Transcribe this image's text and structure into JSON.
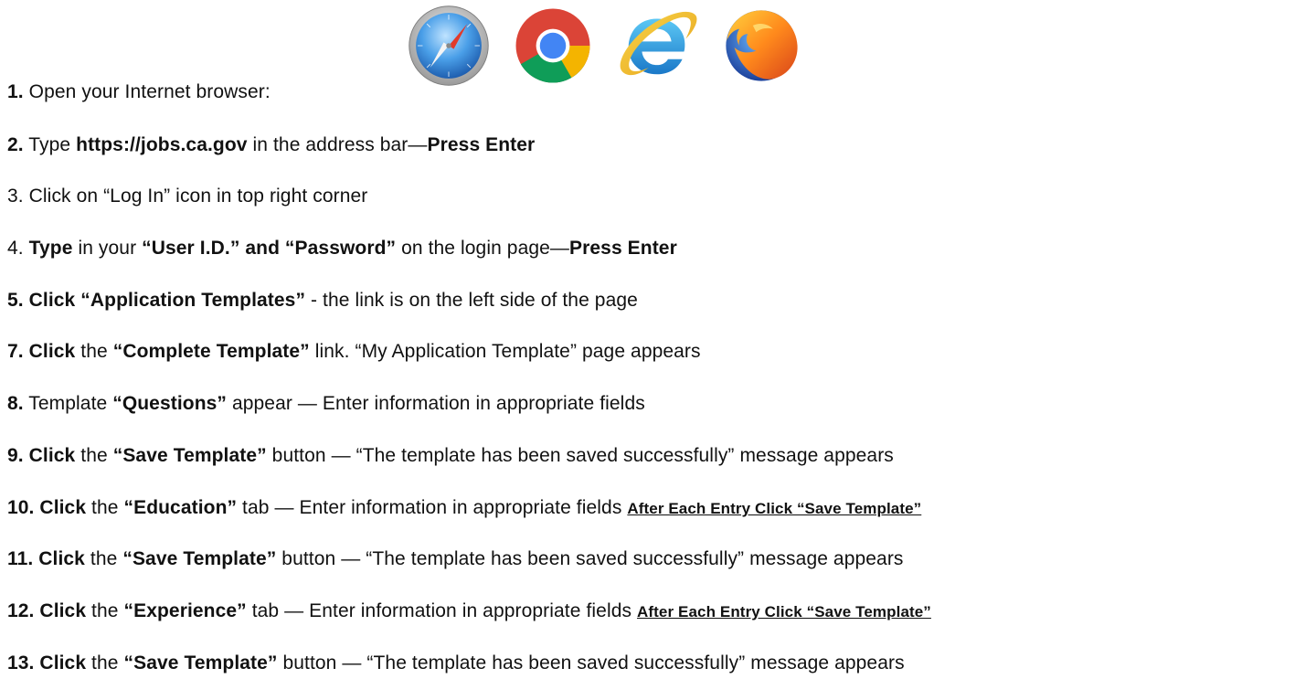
{
  "steps": [
    {
      "id": "step-1",
      "parts": [
        {
          "text": "1.",
          "bold": true
        },
        {
          "text": "  Open your Internet browser:",
          "bold": false
        }
      ]
    },
    {
      "id": "step-2",
      "parts": [
        {
          "text": "2.",
          "bold": true
        },
        {
          "text": " Type ",
          "bold": false
        },
        {
          "text": "https://jobs.ca.gov",
          "bold": true
        },
        {
          "text": " in the address bar—",
          "bold": false
        },
        {
          "text": "Press Enter",
          "bold": true
        }
      ]
    },
    {
      "id": "step-3",
      "parts": [
        {
          "text": "3. Click on “Log In” icon in top right corner",
          "bold": false
        }
      ]
    },
    {
      "id": "step-4",
      "parts": [
        {
          "text": "4. ",
          "bold": false
        },
        {
          "text": "Type",
          "bold": true
        },
        {
          "text": " in your ",
          "bold": false
        },
        {
          "text": "“User I.D.” and “Password”",
          "bold": true
        },
        {
          "text": " on the login page—",
          "bold": false
        },
        {
          "text": "Press Enter",
          "bold": true
        }
      ]
    },
    {
      "id": "step-5",
      "parts": [
        {
          "text": "5. Click  “Application Templates”",
          "bold": true
        },
        {
          "text": " -  the link is on the left side of the page",
          "bold": false
        }
      ]
    },
    {
      "id": "step-7",
      "parts": [
        {
          "text": "7. Click",
          "bold": true
        },
        {
          "text": " the ",
          "bold": false
        },
        {
          "text": "“Complete Template”",
          "bold": true
        },
        {
          "text": " link. “My Application Template” page appears",
          "bold": false
        }
      ]
    },
    {
      "id": "step-8",
      "parts": [
        {
          "text": "8.",
          "bold": true
        },
        {
          "text": " Template ",
          "bold": false
        },
        {
          "text": "“Questions”",
          "bold": true
        },
        {
          "text": " appear — Enter information in appropriate fields",
          "bold": false
        }
      ]
    },
    {
      "id": "step-9",
      "parts": [
        {
          "text": "9. Click",
          "bold": true
        },
        {
          "text": " the ",
          "bold": false
        },
        {
          "text": "“Save Template”",
          "bold": true
        },
        {
          "text": " button — “The template has been saved successfully” message appears",
          "bold": false
        }
      ]
    },
    {
      "id": "step-10",
      "parts": [
        {
          "text": "10. Click",
          "bold": true
        },
        {
          "text": " the ",
          "bold": false
        },
        {
          "text": "“Education”",
          "bold": true
        },
        {
          "text": " tab — Enter information in appropriate fields ",
          "bold": false
        },
        {
          "text": "After Each Entry Click “Save Template”",
          "bold": true,
          "underline": true
        }
      ]
    },
    {
      "id": "step-11",
      "parts": [
        {
          "text": "11. Click",
          "bold": true
        },
        {
          "text": " the ",
          "bold": false
        },
        {
          "text": "“Save Template”",
          "bold": true
        },
        {
          "text": " button — “The template has been saved successfully” message appears",
          "bold": false
        }
      ]
    },
    {
      "id": "step-12",
      "parts": [
        {
          "text": "12. Click",
          "bold": true
        },
        {
          "text": " the ",
          "bold": false
        },
        {
          "text": "“Experience”",
          "bold": true
        },
        {
          "text": " tab — Enter information in appropriate fields ",
          "bold": false
        },
        {
          "text": "After Each Entry Click “Save Template”",
          "bold": true,
          "underline": true
        }
      ]
    },
    {
      "id": "step-13",
      "parts": [
        {
          "text": "13. Click",
          "bold": true
        },
        {
          "text": " the ",
          "bold": false
        },
        {
          "text": "“Save Template”",
          "bold": true
        },
        {
          "text": " button — “The template has been saved successfully” message appears",
          "bold": false
        }
      ]
    }
  ],
  "browser_icons": [
    "safari-icon",
    "chrome-icon",
    "internet-explorer-icon",
    "firefox-icon"
  ]
}
